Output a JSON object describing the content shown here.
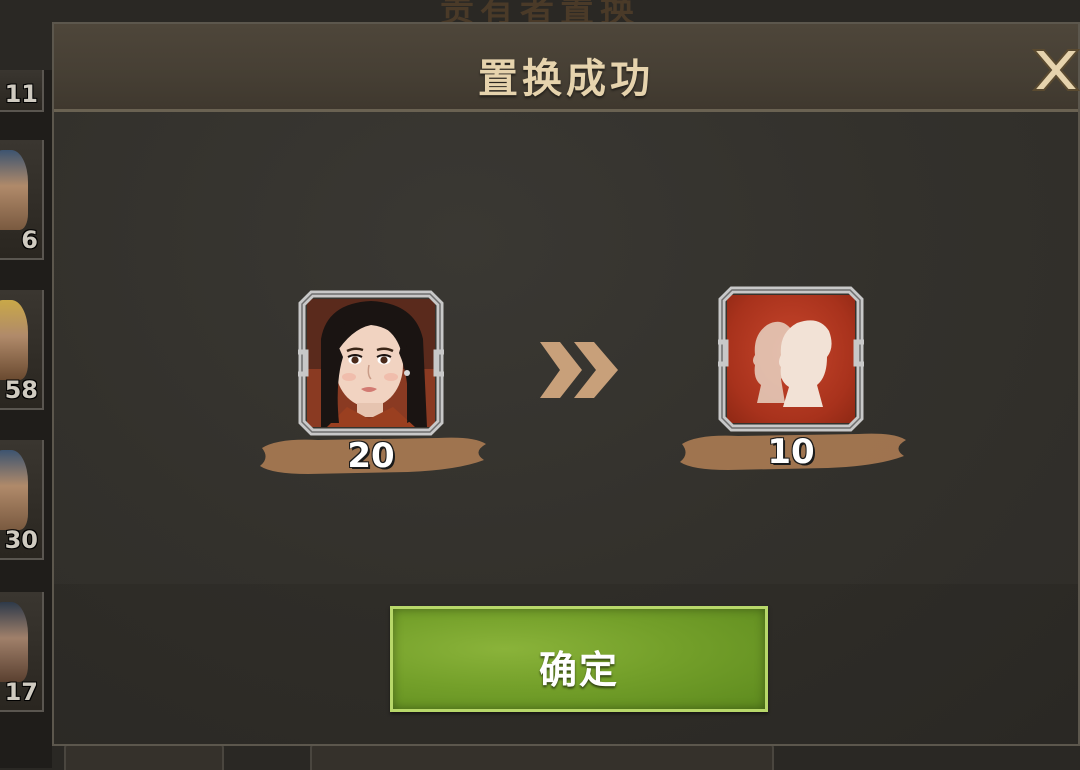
{
  "background": {
    "title": "责有者置换",
    "side_counts": [
      "11",
      "6",
      "58",
      "30",
      "17"
    ]
  },
  "modal": {
    "title": "置换成功",
    "close_icon": "close-x-icon",
    "confirm_label": "确定"
  },
  "exchange": {
    "from": {
      "icon": "heroine-portrait",
      "quantity": "20"
    },
    "arrow_icon": "double-chevron-right-icon",
    "to": {
      "icon": "silhouette-pair-icon",
      "quantity": "10"
    }
  },
  "colors": {
    "accent_green": "#74a02a",
    "title_gold": "#e6d3ad",
    "item_red": "#b23a22"
  }
}
